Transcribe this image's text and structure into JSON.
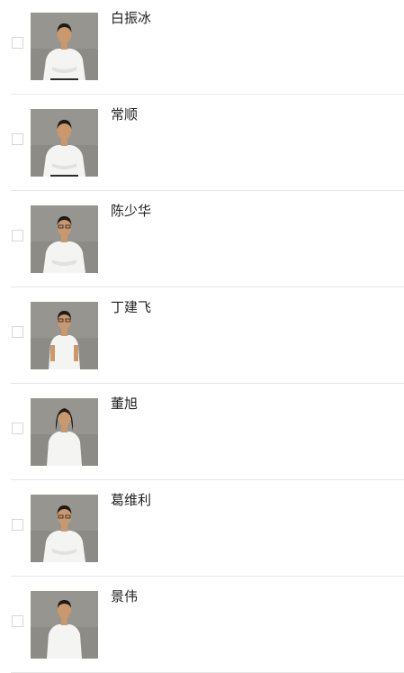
{
  "people": [
    {
      "name": "白振冰",
      "photo": "person-portrait-icon"
    },
    {
      "name": "常顺",
      "photo": "person-portrait-icon"
    },
    {
      "name": "陈少华",
      "photo": "person-portrait-icon"
    },
    {
      "name": "丁建飞",
      "photo": "person-portrait-icon"
    },
    {
      "name": "董旭",
      "photo": "person-portrait-icon"
    },
    {
      "name": "葛维利",
      "photo": "person-portrait-icon"
    },
    {
      "name": "景伟",
      "photo": "person-portrait-icon"
    }
  ],
  "colors": {
    "photo_background": "#8c8b86",
    "shirt": "#f4f4f2",
    "skin": "#c9986f",
    "hair": "#1e1a16",
    "divider": "#e6e6e6",
    "checkbox_border": "#d7d7d7"
  }
}
